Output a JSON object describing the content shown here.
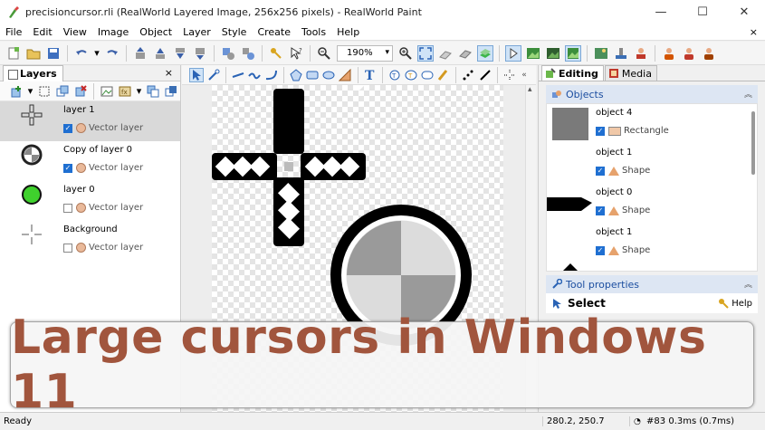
{
  "window": {
    "title": "precisioncursor.rli (RealWorld Layered Image, 256x256 pixels) - RealWorld Paint",
    "minimize": "—",
    "maximize": "☐",
    "close": "✕"
  },
  "menu": {
    "items": [
      "File",
      "Edit",
      "View",
      "Image",
      "Object",
      "Layer",
      "Style",
      "Create",
      "Tools",
      "Help"
    ],
    "close_doc": "×"
  },
  "toolbar": {
    "zoom": "190%"
  },
  "layers_panel": {
    "tab": "Layers",
    "close": "×",
    "layers": [
      {
        "name": "layer 1",
        "sub": "Vector layer",
        "visible": true,
        "selected": true
      },
      {
        "name": "Copy of layer 0",
        "sub": "Vector layer",
        "visible": true,
        "selected": false
      },
      {
        "name": "layer 0",
        "sub": "Vector layer",
        "visible": false,
        "selected": false
      },
      {
        "name": "Background",
        "sub": "Vector layer",
        "visible": false,
        "selected": false
      }
    ]
  },
  "right_panel": {
    "tabs": [
      "Editing",
      "Media"
    ],
    "objects_title": "Objects",
    "objects": [
      {
        "name": "object 4",
        "sub": "Rectangle"
      },
      {
        "name": "object 1",
        "sub": "Shape"
      },
      {
        "name": "object 0",
        "sub": "Shape"
      },
      {
        "name": "object 1",
        "sub": "Shape"
      }
    ],
    "tool_props_title": "Tool properties",
    "tool_name": "Select",
    "help": "Help"
  },
  "status": {
    "ready": "Ready",
    "coords": "280.2, 250.7",
    "perf": "#83 0.3ms (0.7ms)"
  },
  "overlay": {
    "text": "Large cursors in Windows 11"
  },
  "colors": {
    "accent_text": "#a1553d",
    "selection": "#d9d9d9",
    "section_header": "#dde6f3"
  }
}
